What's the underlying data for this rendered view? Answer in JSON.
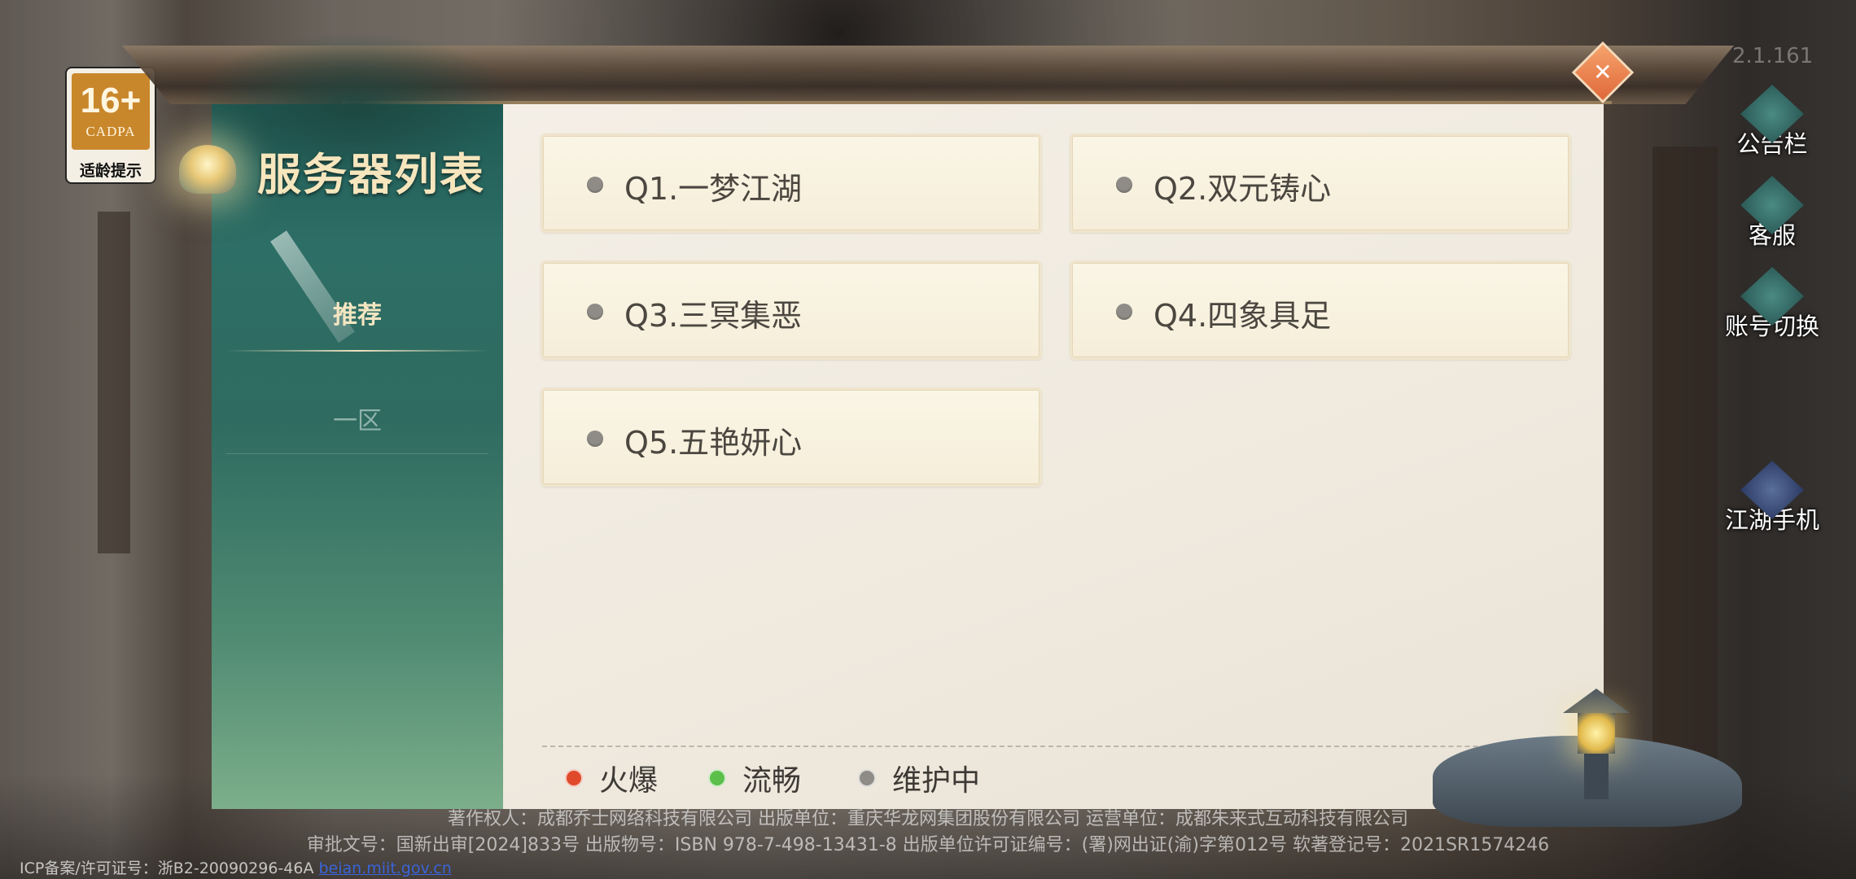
{
  "age_rating": {
    "age": "16+",
    "org": "CADPA",
    "tip": "适龄提示"
  },
  "version": "2.1.161",
  "panel": {
    "title": "服务器列表",
    "categories": [
      {
        "label": "推荐",
        "active": true
      },
      {
        "label": "一区",
        "active": false
      }
    ],
    "servers": [
      {
        "name": "Q1.一梦江湖",
        "status": "维护中"
      },
      {
        "name": "Q2.双元铸心",
        "status": "维护中"
      },
      {
        "name": "Q3.三冥集恶",
        "status": "维护中"
      },
      {
        "name": "Q4.四象具足",
        "status": "维护中"
      },
      {
        "name": "Q5.五艳妍心",
        "status": "维护中"
      }
    ],
    "legend": [
      {
        "label": "火爆",
        "color": "#e04a2a"
      },
      {
        "label": "流畅",
        "color": "#5bbf4a"
      },
      {
        "label": "维护中",
        "color": "#8f8c87"
      }
    ]
  },
  "side_buttons": [
    {
      "label": "公告栏",
      "icon": "notice-board-icon"
    },
    {
      "label": "客服",
      "icon": "customer-service-icon"
    },
    {
      "label": "账号切换",
      "icon": "account-switch-icon"
    },
    {
      "label": "江湖手机",
      "icon": "jianghu-phone-icon"
    }
  ],
  "footer": {
    "line1": "著作权人：成都乔士网络科技有限公司 出版单位：重庆华龙网集团股份有限公司 运营单位：成都朱来式互动科技有限公司",
    "line2": "审批文号：国新出审[2024]833号 出版物号：ISBN 978-7-498-13431-8 出版单位许可证编号：(署)网出证(渝)字第012号 软著登记号：2021SR1574246",
    "icp_label": "ICP备案/许可证号：浙B2-20090296-46A",
    "icp_link": "beian.miit.gov.cn"
  }
}
